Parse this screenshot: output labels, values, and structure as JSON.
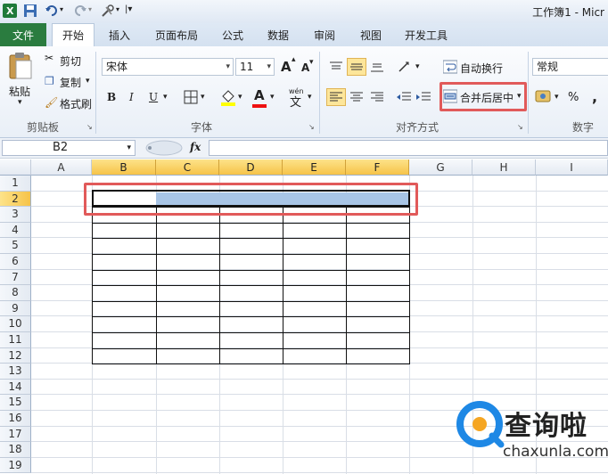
{
  "app": {
    "title": "工作簿1 - Micr"
  },
  "tabs": [
    "文件",
    "开始",
    "插入",
    "页面布局",
    "公式",
    "数据",
    "审阅",
    "视图",
    "开发工具"
  ],
  "ribbon": {
    "clipboard": {
      "paste": "粘贴",
      "cut": "剪切",
      "copy": "复制",
      "format_painter": "格式刷",
      "group_label": "剪贴板"
    },
    "font": {
      "font_name": "宋体",
      "font_size": "11",
      "bold": "B",
      "italic": "I",
      "underline": "U",
      "group_label": "字体",
      "grow": "A",
      "shrink": "A",
      "font_color_glyph": "A",
      "phonetic": "wén"
    },
    "alignment": {
      "wrap_text": "自动换行",
      "merge_center": "合并后居中",
      "group_label": "对齐方式"
    },
    "number": {
      "format": "常规",
      "percent": "%",
      "comma": ",",
      "group_label": "数字"
    }
  },
  "formula_bar": {
    "name_box": "B2",
    "fx": "fx",
    "formula": ""
  },
  "sheet": {
    "columns": [
      "A",
      "B",
      "C",
      "D",
      "E",
      "F",
      "G",
      "H",
      "I"
    ],
    "rows": [
      "1",
      "2",
      "3",
      "4",
      "5",
      "6",
      "7",
      "8",
      "9",
      "10",
      "11",
      "12",
      "13",
      "14",
      "15",
      "16",
      "17",
      "18",
      "19"
    ],
    "selected_cell": "B2"
  },
  "watermark": {
    "name": "查询啦",
    "url": "chaxunla.com"
  },
  "colors": {
    "file_tab": "#2a7c3f",
    "selection_header": "#f6c348",
    "merge_fill": "#a8c5e6",
    "highlight_box": "#e15a5a"
  }
}
